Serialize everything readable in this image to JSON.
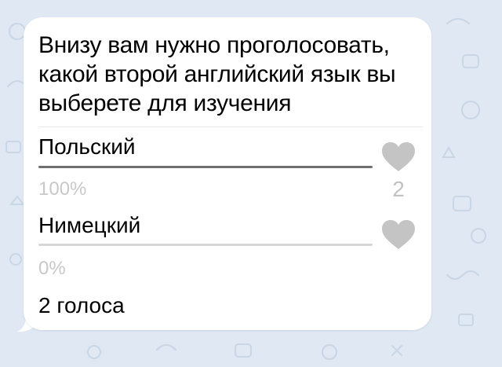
{
  "poll": {
    "question": "Внизу вам нужно проголосовать, какой второй английский язык вы выберете для изучения",
    "options": [
      {
        "label": "Польский",
        "percent_text": "100%",
        "fraction": 1.0,
        "votes_text": "2"
      },
      {
        "label": "Нимецкий",
        "percent_text": "0%",
        "fraction": 0.0,
        "votes_text": ""
      }
    ],
    "total_votes": "2 голоса"
  },
  "colors": {
    "background": "#dfe8f3",
    "bubble": "#ffffff",
    "bar_fill": "#6f6f6f",
    "bar_track": "#d6d6d6",
    "heart": "#c4c4c4",
    "muted_text": "#c8c8c8"
  },
  "icons": {
    "vote": "heart-icon",
    "wallpaper": "doodle-pattern"
  }
}
